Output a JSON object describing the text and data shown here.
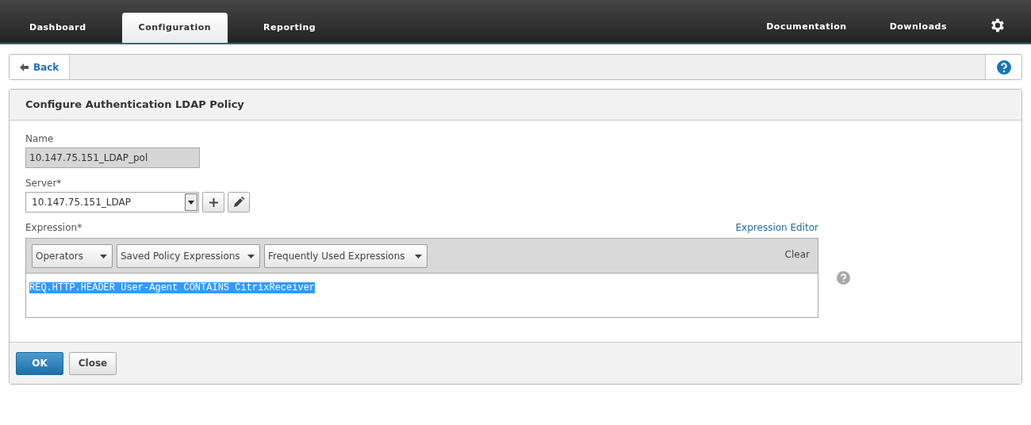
{
  "nav": {
    "tabs": [
      {
        "label": "Dashboard",
        "selected": false
      },
      {
        "label": "Configuration",
        "selected": true
      },
      {
        "label": "Reporting",
        "selected": false
      }
    ],
    "links": [
      "Documentation",
      "Downloads"
    ]
  },
  "back_button": "Back",
  "panel": {
    "title": "Configure Authentication LDAP Policy",
    "name": {
      "label": "Name",
      "value": "10.147.75.151_LDAP_pol",
      "disabled": true
    },
    "server": {
      "label": "Server*",
      "value": "10.147.75.151_LDAP"
    },
    "expression": {
      "label": "Expression*",
      "editor_link": "Expression Editor",
      "dropdowns": [
        "Operators",
        "Saved Policy Expressions",
        "Frequently Used Expressions"
      ],
      "clear": "Clear",
      "value": "REQ.HTTP.HEADER User-Agent CONTAINS CitrixReceiver",
      "selected": true
    },
    "buttons": [
      {
        "label": "OK",
        "kind": "primary"
      },
      {
        "label": "Close",
        "kind": "secondary"
      }
    ]
  }
}
